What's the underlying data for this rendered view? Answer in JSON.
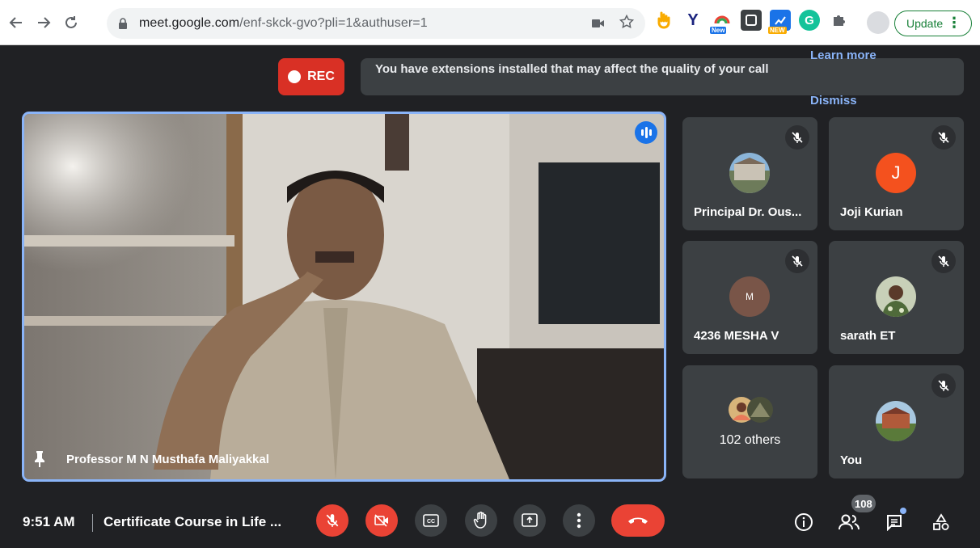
{
  "browser": {
    "url_host": "meet.google.com",
    "url_path": "/enf-skck-gvo?pli=1&authuser=1",
    "update_label": "Update",
    "ext_new_label": "New",
    "ext_new2_label": "NEW"
  },
  "banner": {
    "rec_label": "REC",
    "message": "You have extensions installed that may affect the quality of your call",
    "learn_more": "Learn more",
    "dismiss": "Dismiss"
  },
  "main_video": {
    "name": "Professor M N Musthafa Maliyakkal"
  },
  "participants": [
    {
      "name": "Principal Dr. Ous...",
      "avatar": "photo",
      "muted": true
    },
    {
      "name": "Joji Kurian",
      "avatar_letter": "J",
      "avatar_color": "#f4511e",
      "muted": true
    },
    {
      "name": "4236 MESHA V",
      "avatar_letter": "M",
      "avatar_color": "#795548",
      "muted": true
    },
    {
      "name": "sarath ET",
      "avatar": "photo",
      "muted": true
    },
    {
      "name": "102 others",
      "avatar": "group"
    },
    {
      "name": "You",
      "avatar": "photo",
      "muted": true
    }
  ],
  "bottom_bar": {
    "time": "9:51 AM",
    "meeting_title": "Certificate Course in Life ...",
    "participant_count": "108"
  },
  "colors": {
    "accent": "#8ab4f8",
    "danger": "#ea4335",
    "tile": "#3c4043",
    "background": "#202124"
  }
}
